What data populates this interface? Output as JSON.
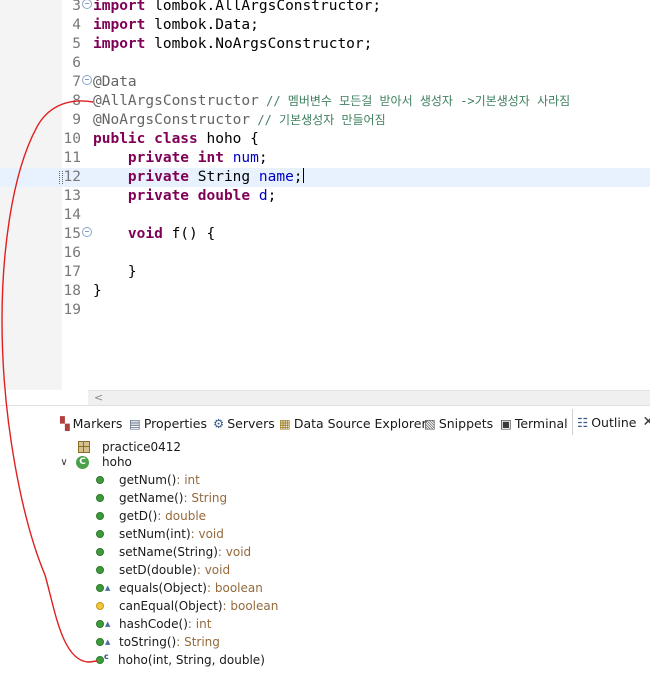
{
  "editor": {
    "lines": [
      {
        "num": "3",
        "fold": true,
        "segments": [
          {
            "c": "kw",
            "t": "import"
          },
          {
            "c": "plain",
            "t": " lombok.AllArgsConstructor;"
          }
        ]
      },
      {
        "num": "4",
        "segments": [
          {
            "c": "kw",
            "t": "import"
          },
          {
            "c": "plain",
            "t": " lombok.Data;"
          }
        ]
      },
      {
        "num": "5",
        "segments": [
          {
            "c": "kw",
            "t": "import"
          },
          {
            "c": "plain",
            "t": " lombok.NoArgsConstructor;"
          }
        ]
      },
      {
        "num": "6",
        "segments": []
      },
      {
        "num": "7",
        "fold": true,
        "segments": [
          {
            "c": "ann",
            "t": "@Data"
          }
        ]
      },
      {
        "num": "8",
        "segments": [
          {
            "c": "ann",
            "t": "@AllArgsConstructor"
          },
          {
            "c": "cmt",
            "t": " // 멤버변수 모든걸 받아서 생성자 ->기본생성자 사라짐"
          }
        ]
      },
      {
        "num": "9",
        "segments": [
          {
            "c": "ann",
            "t": "@NoArgsConstructor"
          },
          {
            "c": "cmt",
            "t": " // 기본생성자 만들어짐"
          }
        ]
      },
      {
        "num": "10",
        "segments": [
          {
            "c": "kw",
            "t": "public class"
          },
          {
            "c": "plain",
            "t": " hoho {"
          }
        ]
      },
      {
        "num": "11",
        "segments": [
          {
            "c": "plain",
            "t": "    "
          },
          {
            "c": "kw",
            "t": "private int"
          },
          {
            "c": "plain",
            "t": " "
          },
          {
            "c": "fld",
            "t": "num"
          },
          {
            "c": "plain",
            "t": ";"
          }
        ]
      },
      {
        "num": "12",
        "current": true,
        "caret": true,
        "segments": [
          {
            "c": "plain",
            "t": "    "
          },
          {
            "c": "kw",
            "t": "private"
          },
          {
            "c": "plain",
            "t": " String "
          },
          {
            "c": "fld",
            "t": "name"
          },
          {
            "c": "plain",
            "t": ";"
          }
        ]
      },
      {
        "num": "13",
        "segments": [
          {
            "c": "plain",
            "t": "    "
          },
          {
            "c": "kw",
            "t": "private double"
          },
          {
            "c": "plain",
            "t": " "
          },
          {
            "c": "fld",
            "t": "d"
          },
          {
            "c": "plain",
            "t": ";"
          }
        ]
      },
      {
        "num": "14",
        "segments": []
      },
      {
        "num": "15",
        "fold": true,
        "segments": [
          {
            "c": "plain",
            "t": "    "
          },
          {
            "c": "kw",
            "t": "void"
          },
          {
            "c": "plain",
            "t": " f() {"
          }
        ]
      },
      {
        "num": "16",
        "segments": []
      },
      {
        "num": "17",
        "segments": [
          {
            "c": "plain",
            "t": "    }"
          }
        ]
      },
      {
        "num": "18",
        "segments": [
          {
            "c": "plain",
            "t": "}"
          }
        ]
      },
      {
        "num": "19",
        "segments": []
      }
    ]
  },
  "scroll_arrow": "<",
  "tabs": [
    {
      "id": "markers",
      "label": "Markers",
      "icon": "markers-icon",
      "glyph": "▚",
      "color": "#b04040"
    },
    {
      "id": "properties",
      "label": "Properties",
      "icon": "properties-icon",
      "glyph": "▤",
      "color": "#5a6a80"
    },
    {
      "id": "servers",
      "label": "Servers",
      "icon": "servers-icon",
      "glyph": "⚙",
      "color": "#3a5a8a"
    },
    {
      "id": "data-source-explorer",
      "label": "Data Source Explorer",
      "icon": "database-icon",
      "glyph": "▦",
      "color": "#9a7a20"
    },
    {
      "id": "snippets",
      "label": "Snippets",
      "icon": "snippets-icon",
      "glyph": "▧",
      "color": "#5a5a5a"
    },
    {
      "id": "terminal",
      "label": "Terminal",
      "icon": "terminal-icon",
      "glyph": "▣",
      "color": "#3a3a3a"
    },
    {
      "id": "outline",
      "label": "Outline",
      "icon": "outline-icon",
      "glyph": "☷",
      "color": "#3a5a8a",
      "active": true
    }
  ],
  "outline": {
    "package": "practice0412",
    "class_name": "hoho",
    "class_icon_letter": "C",
    "members": [
      {
        "name": "getNum()",
        "type": " : int",
        "marker": ""
      },
      {
        "name": "getName()",
        "type": " : String",
        "marker": ""
      },
      {
        "name": "getD()",
        "type": " : double",
        "marker": ""
      },
      {
        "name": "setNum(int)",
        "type": " : void",
        "marker": ""
      },
      {
        "name": "setName(String)",
        "type": " : void",
        "marker": ""
      },
      {
        "name": "setD(double)",
        "type": " : void",
        "marker": ""
      },
      {
        "name": "equals(Object)",
        "type": " : boolean",
        "marker": "override"
      },
      {
        "name": "canEqual(Object)",
        "type": " : boolean",
        "marker": "",
        "protected": true
      },
      {
        "name": "hashCode()",
        "type": " : int",
        "marker": "override"
      },
      {
        "name": "toString()",
        "type": " : String",
        "marker": "override"
      },
      {
        "name": "hoho(int, String, double)",
        "type": "",
        "marker": "constructor"
      }
    ]
  },
  "colors": {
    "keyword": "#7f0055",
    "field": "#0000c0",
    "comment": "#3f7f5f",
    "annotation": "#646464",
    "annotation_ink": "#e02020"
  }
}
